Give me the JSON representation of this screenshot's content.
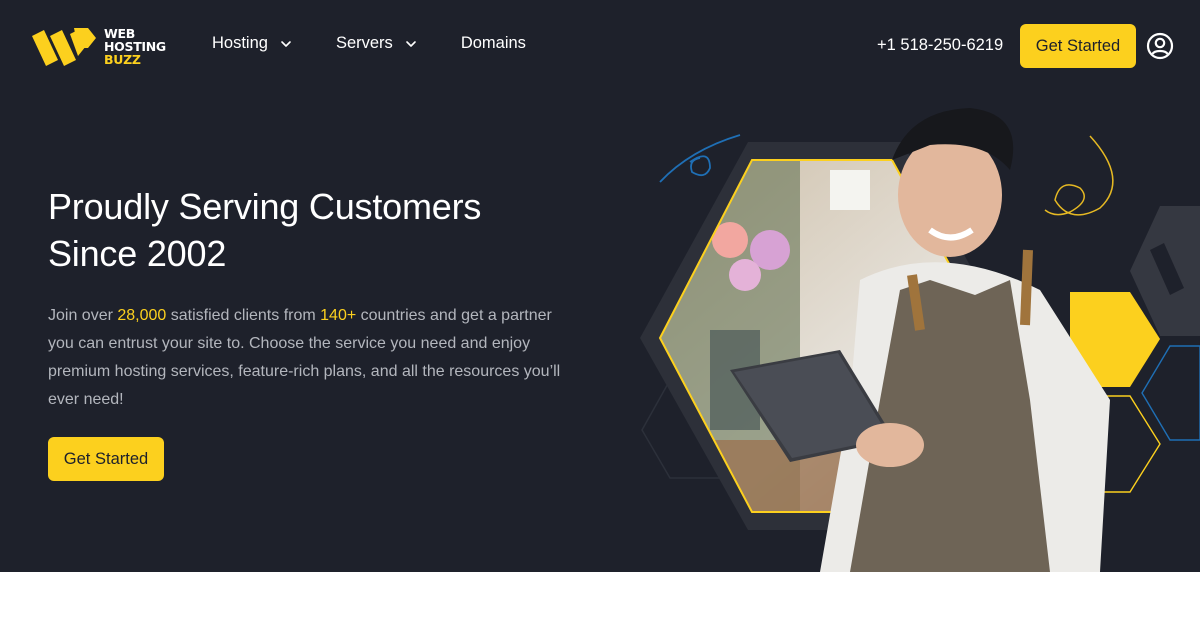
{
  "brand": {
    "name_line1": "WEB",
    "name_line2": "HOSTING",
    "name_line3": "BUZZ",
    "accent_color": "#fcd01e",
    "background_color": "#1e212b"
  },
  "nav": {
    "items": [
      {
        "label": "Hosting",
        "has_dropdown": true,
        "icon": "chevron-down-icon"
      },
      {
        "label": "Servers",
        "has_dropdown": true,
        "icon": "chevron-down-icon"
      },
      {
        "label": "Domains",
        "has_dropdown": false
      }
    ]
  },
  "header": {
    "phone": "+1 518-250-6219",
    "cta_label": "Get Started",
    "account_icon": "user-circle-icon"
  },
  "hero": {
    "title_line1": "Proudly Serving Customers",
    "title_line2": "Since 2002",
    "desc_part1": "Join over ",
    "desc_highlight1": "28,000",
    "desc_part2": " satisfied clients from ",
    "desc_highlight2": "140+",
    "desc_part3": " countries and get a partner you can entrust your site to. Choose the service you need and enjoy premium hosting services, feature-rich plans, and all the resources you’ll ever need!",
    "cta_label": "Get Started",
    "image_alt": "Smiling florist in apron using a tablet inside a hexagon frame"
  }
}
